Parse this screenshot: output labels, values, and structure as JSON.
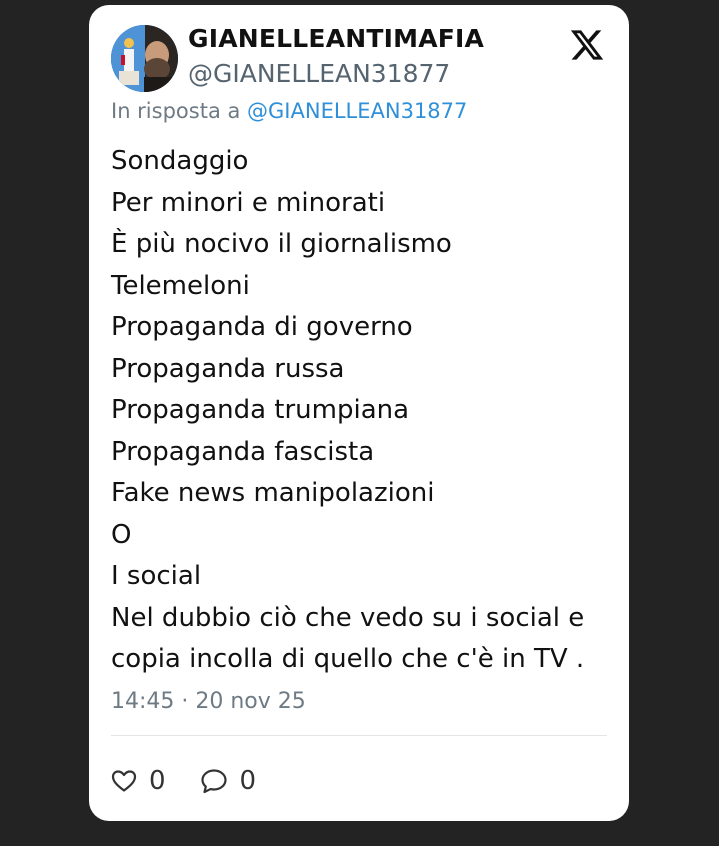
{
  "tweet": {
    "author": {
      "display_name": "GIANELLEANTIMAFIA",
      "handle": "@GIANELLEAN31877",
      "avatar_icon": "profile-photo-avatar"
    },
    "platform_icon": "x-logo-icon",
    "reply_prefix": "In risposta a ",
    "reply_to": "@GIANELLEAN31877",
    "lines": [
      "Sondaggio",
      "Per minori e minorati",
      "È più nocivo il giornalismo",
      "Telemeloni",
      "Propaganda di governo",
      "Propaganda russa",
      "Propaganda trumpiana",
      "Propaganda fascista",
      "Fake news manipolazioni",
      "O",
      "I social",
      "Nel dubbio ciò che vedo su i social e",
      "copia incolla di quello che c'è in TV ."
    ],
    "timestamp": "14:45 · 20 nov 25",
    "actions": {
      "like_icon": "heart-icon",
      "like_count": "0",
      "reply_icon": "speech-bubble-icon",
      "reply_count": "0"
    }
  },
  "colors": {
    "page_background": "#232323",
    "card_background": "#ffffff",
    "text_primary": "#111111",
    "text_secondary": "#6e7a84",
    "mention": "#2f8fd8"
  }
}
